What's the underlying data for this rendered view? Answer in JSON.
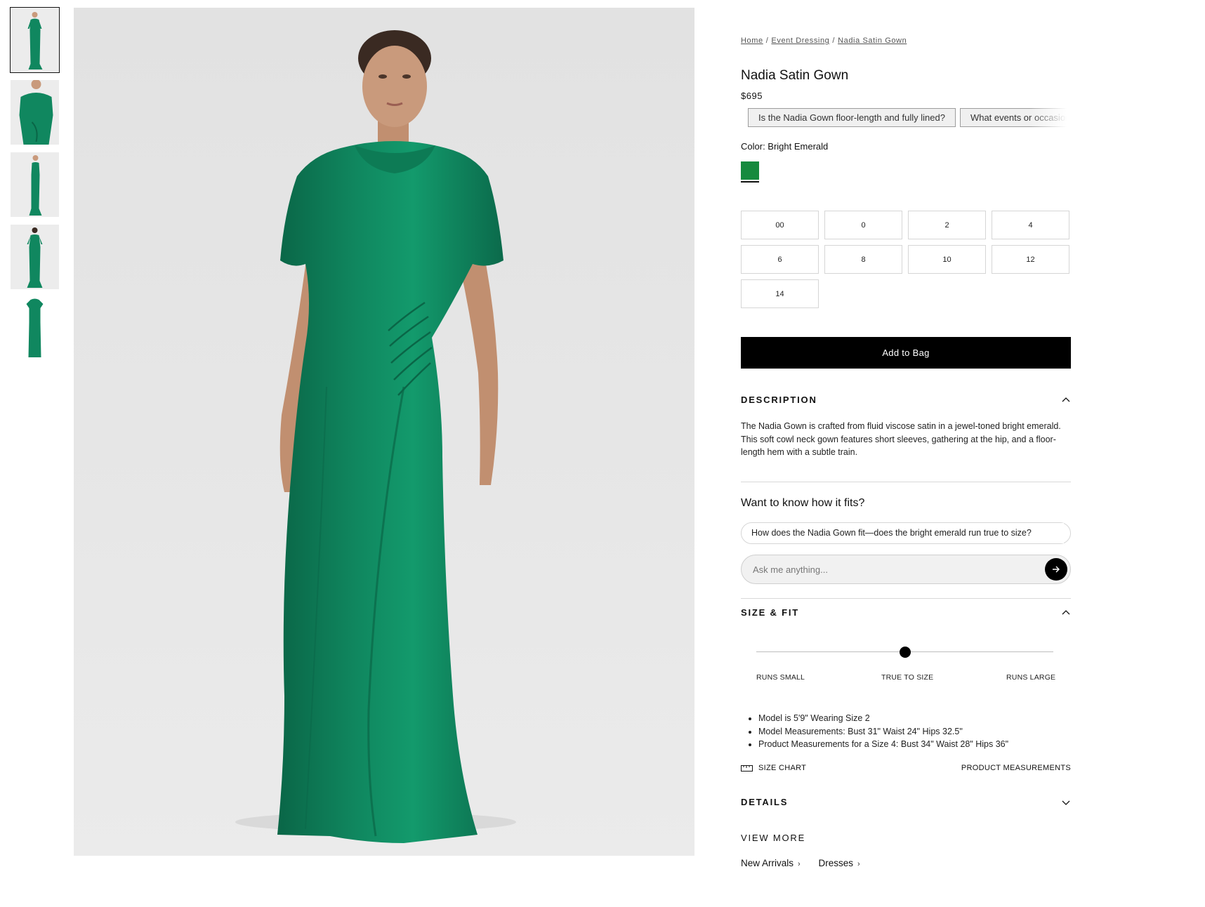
{
  "breadcrumb": [
    "Home",
    "Event Dressing",
    "Nadia Satin Gown"
  ],
  "product": {
    "title": "Nadia Satin Gown",
    "price": "$695",
    "color_label": "Color: Bright Emerald",
    "swatch_color": "#168a3e"
  },
  "chips": [
    "Is the Nadia Gown floor-length and fully lined?",
    "What events or occasions"
  ],
  "sizes": [
    "00",
    "0",
    "2",
    "4",
    "6",
    "8",
    "10",
    "12",
    "14"
  ],
  "add_to_bag": "Add to Bag",
  "description": {
    "title": "DESCRIPTION",
    "text": "The Nadia Gown is crafted from fluid viscose satin in a jewel-toned bright emerald. This soft cowl neck gown features short sleeves, gathering at the hip, and a floor-length hem with a subtle train."
  },
  "fit": {
    "title": "Want to know how it fits?",
    "question": "How does the Nadia Gown fit—does the bright emerald run true to size?",
    "placeholder": "Ask me anything..."
  },
  "size_fit": {
    "title": "SIZE & FIT",
    "scale": [
      "RUNS SMALL",
      "TRUE TO SIZE",
      "RUNS LARGE"
    ],
    "fit_position": 0.5,
    "bullets": [
      "Model is 5'9\" Wearing Size 2",
      "Model Measurements: Bust 31\" Waist 24\" Hips 32.5\"",
      "Product Measurements for a Size 4: Bust 34\" Waist 28\" Hips 36\""
    ],
    "size_chart": "SIZE CHART",
    "product_measurements": "PRODUCT MEASUREMENTS"
  },
  "details": {
    "title": "DETAILS"
  },
  "view_more": {
    "title": "VIEW MORE",
    "links": [
      "New Arrivals",
      "Dresses"
    ]
  },
  "colors": {
    "gown": "#10875f",
    "gown_shadow": "#0a6647",
    "skin": "#c99a7c",
    "hair": "#3a2a22",
    "accent": "#000000"
  }
}
